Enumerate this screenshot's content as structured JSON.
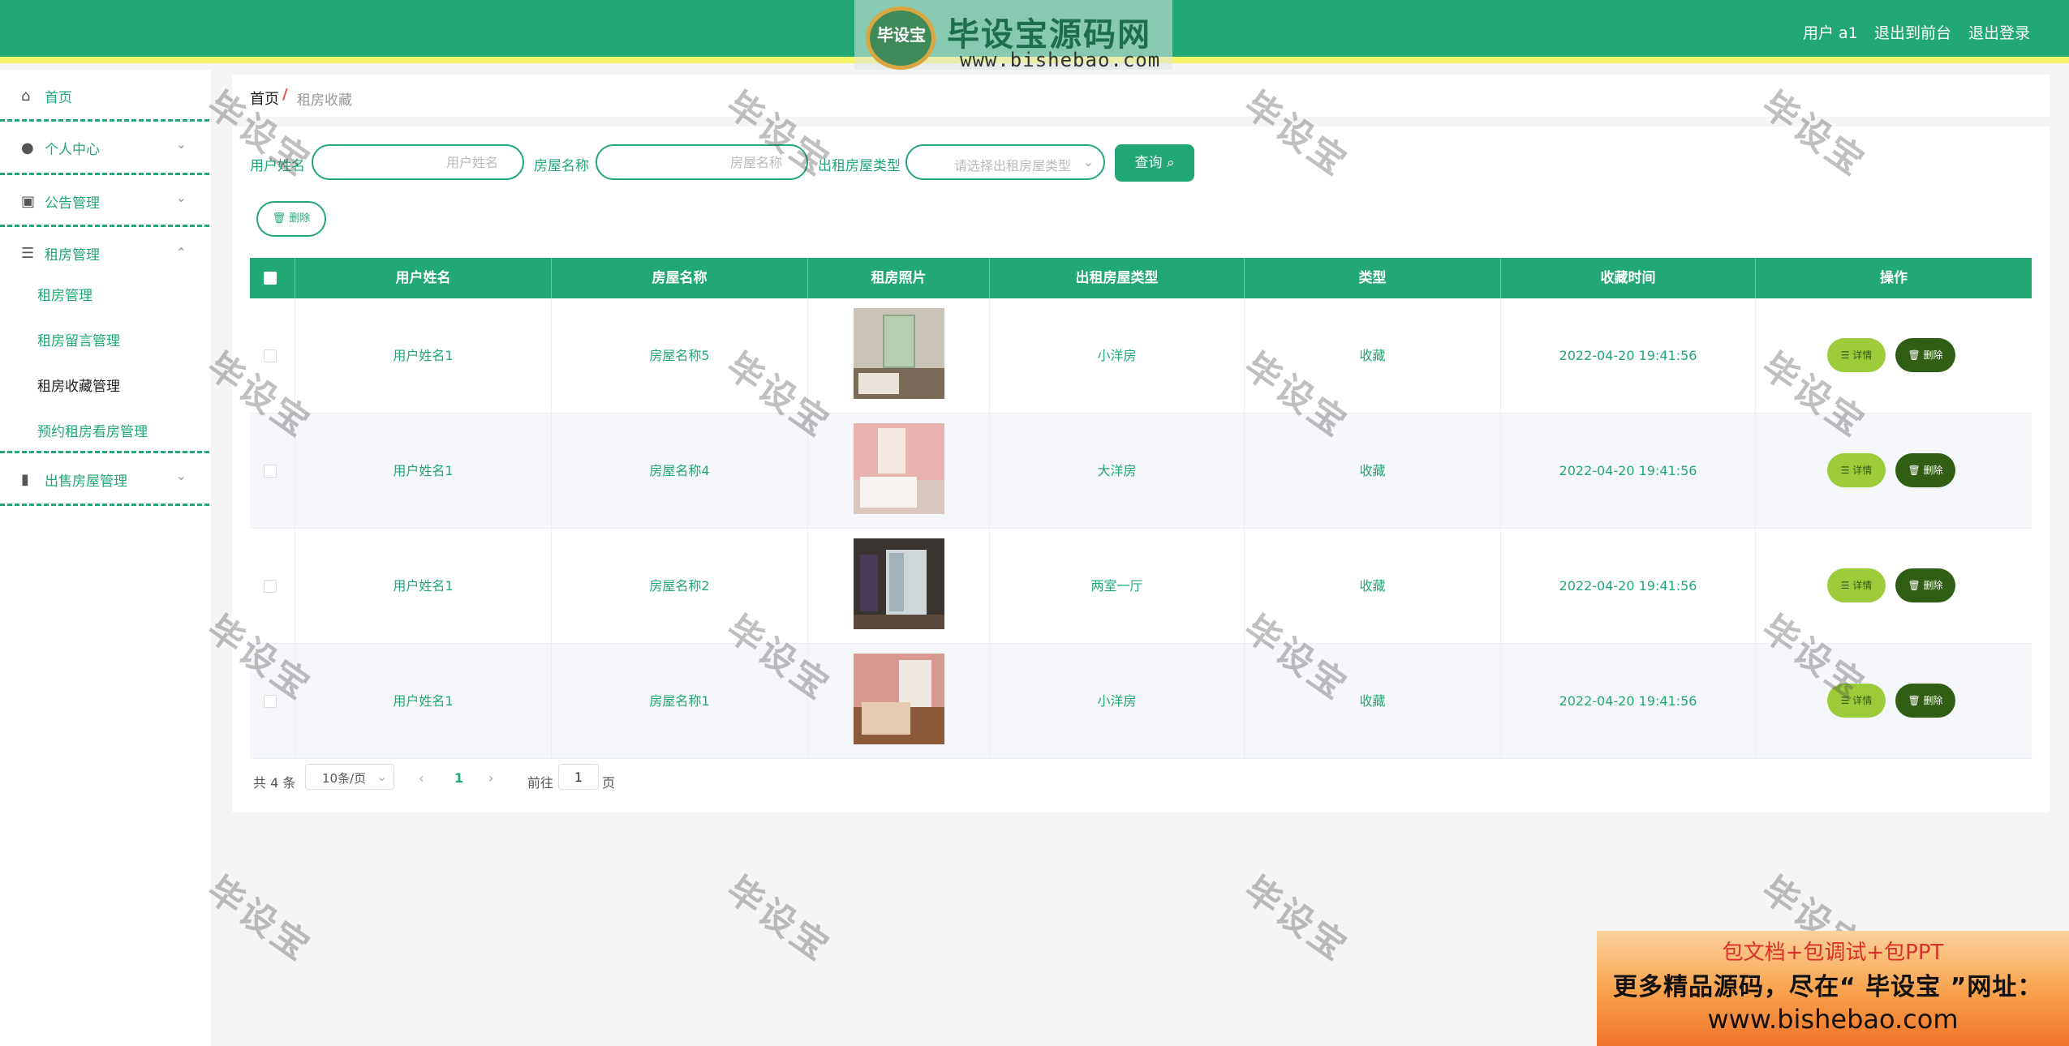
{
  "header": {
    "logo_badge": "毕设宝",
    "logo_title": "毕设宝源码网",
    "logo_url": "www.bishebao.com",
    "user": "用户 a1",
    "to_front": "退出到前台",
    "logout": "退出登录"
  },
  "sidebar": {
    "home": "首页",
    "personal": "个人中心",
    "notice": "公告管理",
    "rental": "租房管理",
    "rental_sub": [
      "租房管理",
      "租房留言管理",
      "租房收藏管理",
      "预约租房看房管理"
    ],
    "sale": "出售房屋管理"
  },
  "breadcrumb": {
    "home": "首页",
    "sep": "/",
    "current": "租房收藏"
  },
  "filters": {
    "user_label": "用户姓名",
    "user_placeholder": "用户姓名",
    "house_label": "房屋名称",
    "house_placeholder": "房屋名称",
    "type_label": "出租房屋类型",
    "type_placeholder": "请选择出租房屋类型",
    "query_button": "查询",
    "delete_button": "删除"
  },
  "table": {
    "columns": [
      "用户姓名",
      "房屋名称",
      "租房照片",
      "出租房屋类型",
      "类型",
      "收藏时间",
      "操作"
    ],
    "rows": [
      {
        "user": "用户姓名1",
        "house": "房屋名称5",
        "type": "小洋房",
        "kind": "收藏",
        "time": "2022-04-20 19:41:56"
      },
      {
        "user": "用户姓名1",
        "house": "房屋名称4",
        "type": "大洋房",
        "kind": "收藏",
        "time": "2022-04-20 19:41:56"
      },
      {
        "user": "用户姓名1",
        "house": "房屋名称2",
        "type": "两室一厅",
        "kind": "收藏",
        "time": "2022-04-20 19:41:56"
      },
      {
        "user": "用户姓名1",
        "house": "房屋名称1",
        "type": "小洋房",
        "kind": "收藏",
        "time": "2022-04-20 19:41:56"
      }
    ],
    "detail_label": "详情",
    "delete_label": "删除"
  },
  "pagination": {
    "total": "共 4 条",
    "page_size": "10条/页",
    "current_page": "1",
    "goto": "前往",
    "goto_value": "1",
    "page_suffix": "页"
  },
  "watermark": "毕设宝",
  "ad": {
    "line1": "包文档+包调试+包PPT",
    "line2": "更多精品源码，尽在“ 毕设宝 ”网址：",
    "line3": "www.bishebao.com"
  },
  "colors": {
    "primary": "#21a875",
    "accent_bar": "#f5f56a",
    "detail_btn": "#9ccc3a",
    "delete_btn": "#2f5e14"
  }
}
